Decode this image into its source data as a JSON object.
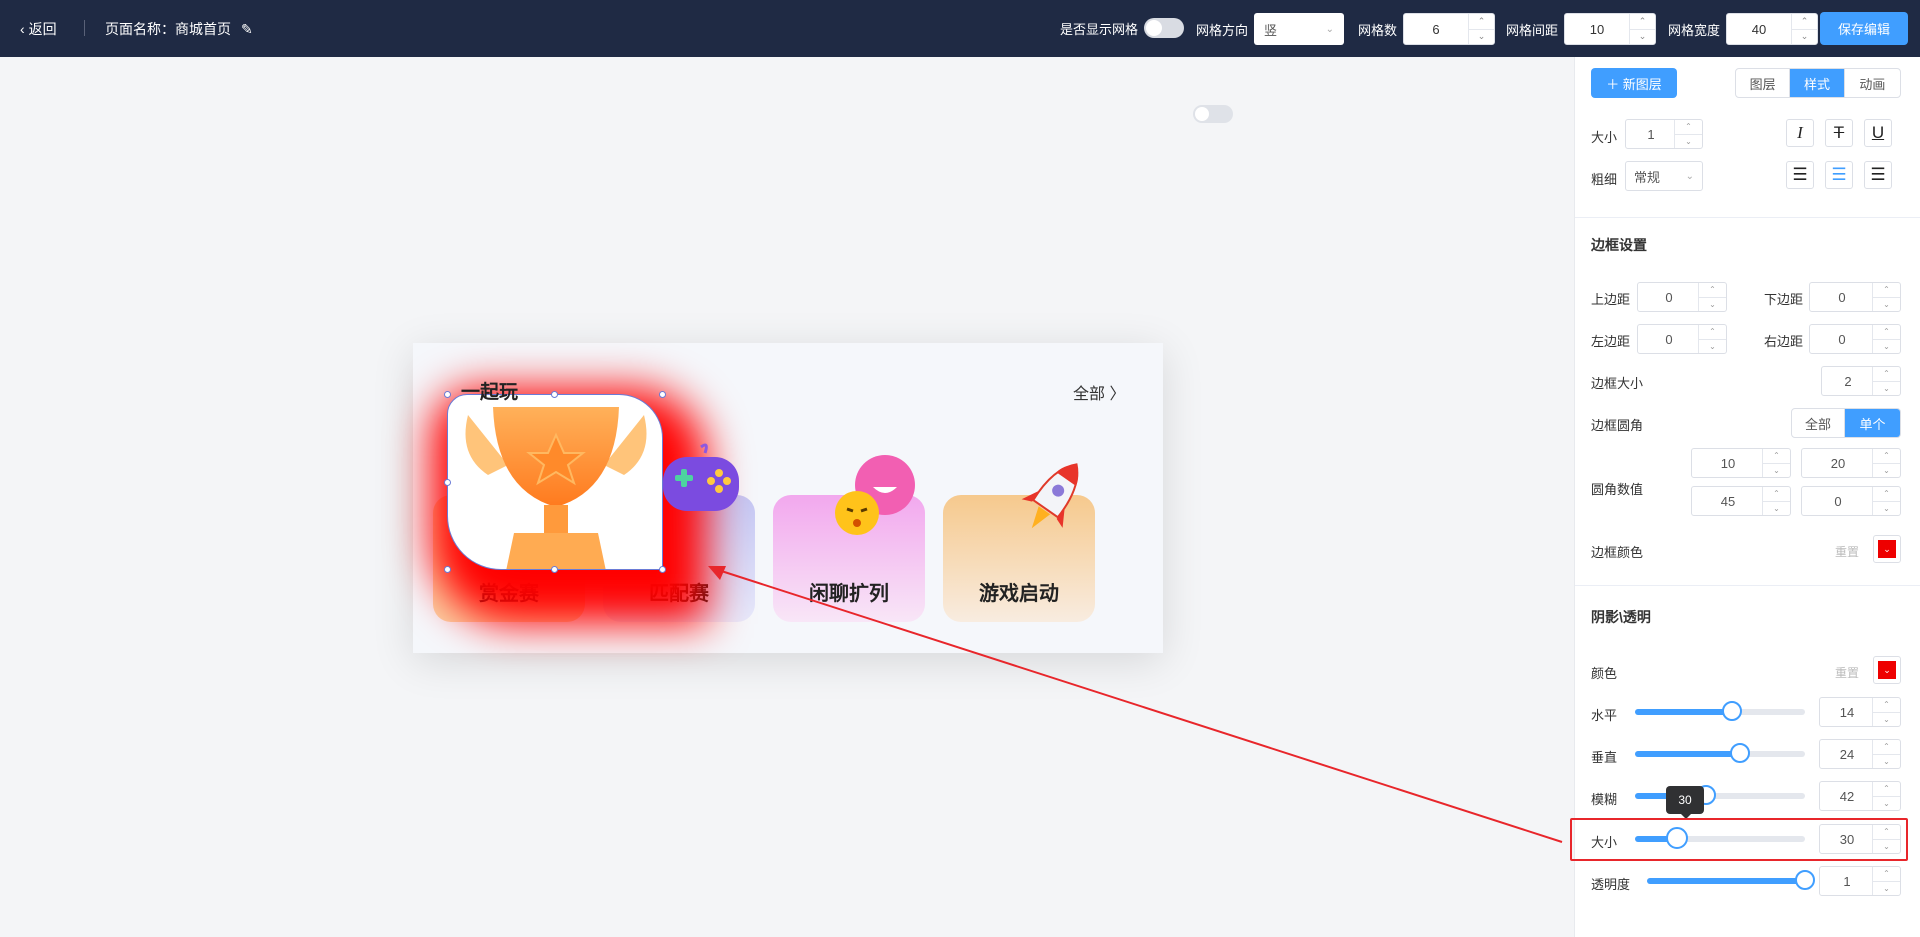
{
  "topbar": {
    "back_label": "返回",
    "page_name": "页面名称：商城首页",
    "show_grid_label": "是否显示网格",
    "grid_direction_label": "网格方向",
    "grid_direction_value": "竖",
    "grid_count_label": "网格数",
    "grid_count_value": "6",
    "grid_gap_label": "网格间距",
    "grid_gap_value": "10",
    "grid_width_label": "网格宽度",
    "grid_width_value": "40",
    "save_label": "保存编辑"
  },
  "card": {
    "title": "一起玩",
    "all_label": "全部 〉",
    "tiles": [
      {
        "label": "赏金赛",
        "color": "#fbd4a5"
      },
      {
        "label": "匹配赛",
        "color": "#c9cdf5"
      },
      {
        "label": "闲聊扩列",
        "color": "#f7c4ef"
      },
      {
        "label": "游戏启动",
        "color": "#f6d1a0"
      }
    ]
  },
  "panel": {
    "new_layer": "＋ 新图层",
    "tabs": [
      "图层",
      "样式",
      "动画"
    ],
    "active_tab": "样式",
    "font_size_label": "大小",
    "font_size_value": "1",
    "weight_label": "粗细",
    "weight_value": "常规",
    "border_section": "边框设置",
    "margin_top_label": "上边距",
    "margin_top_value": "0",
    "margin_bottom_label": "下边距",
    "margin_bottom_value": "0",
    "margin_left_label": "左边距",
    "margin_left_value": "0",
    "margin_right_label": "右边距",
    "margin_right_value": "0",
    "border_size_label": "边框大小",
    "border_size_value": "2",
    "radius_label": "边框圆角",
    "radius_modes": [
      "全部",
      "单个"
    ],
    "radius_active": "单个",
    "radius_values_label": "圆角数值",
    "radius_values": [
      "10",
      "20",
      "45",
      "0"
    ],
    "border_color_label": "边框颜色",
    "reset_label": "重置",
    "border_color": "#e00000",
    "shadow_section": "阴影\\透明",
    "shadow_color_label": "颜色",
    "shadow_color": "#e00000",
    "sliders": [
      {
        "label": "水平",
        "value": "14",
        "fraction": 0.57
      },
      {
        "label": "垂直",
        "value": "24",
        "fraction": 0.62
      },
      {
        "label": "模糊",
        "value": "42",
        "fraction": 0.42
      },
      {
        "label": "大小",
        "value": "30",
        "fraction": 0.3
      },
      {
        "label": "透明度",
        "value": "1",
        "fraction": 1.0
      }
    ],
    "tooltip": "30"
  }
}
